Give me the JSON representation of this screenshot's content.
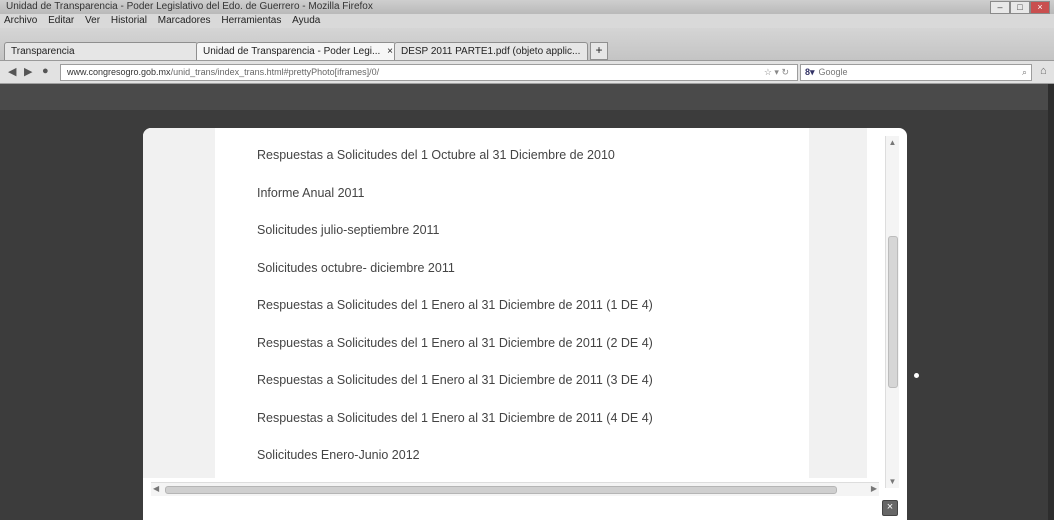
{
  "window": {
    "title": "Unidad de Transparencia - Poder Legislativo del Edo. de Guerrero - Mozilla Firefox",
    "controls": [
      "–",
      "□",
      "×"
    ]
  },
  "menu": [
    "Archivo",
    "Editar",
    "Ver",
    "Historial",
    "Marcadores",
    "Herramientas",
    "Ayuda"
  ],
  "tabs": [
    {
      "label": "Transparencia",
      "active": false
    },
    {
      "label": "Unidad de Transparencia - Poder Legi...",
      "active": true
    },
    {
      "label": "DESP 2011 PARTE1.pdf (objeto applic...",
      "active": false
    }
  ],
  "navbar": {
    "url_host": "www.congresogro.gob.mx",
    "url_path": "/unid_trans/index_trans.html#prettyPhoto[iframes]/0/",
    "search_engine": "Google",
    "search_placeholder": "Google"
  },
  "items": [
    "Respuestas a Solicitudes del 1 Octubre al 31 Diciembre de 2010",
    "Informe Anual 2011",
    "Solicitudes julio-septiembre 2011",
    "Solicitudes octubre- diciembre 2011",
    "Respuestas a Solicitudes del 1 Enero al 31 Diciembre de 2011 (1 DE 4)",
    "Respuestas a Solicitudes del 1 Enero al 31 Diciembre de 2011 (2 DE 4)",
    "Respuestas a Solicitudes del 1 Enero al 31 Diciembre de 2011 (3 DE 4)",
    "Respuestas a Solicitudes del 1 Enero al 31 Diciembre de 2011 (4 DE 4)",
    "Solicitudes Enero-Junio 2012"
  ],
  "icons": {
    "back": "back-arrow-icon",
    "forward": "forward-arrow-icon",
    "close": "close-icon"
  }
}
